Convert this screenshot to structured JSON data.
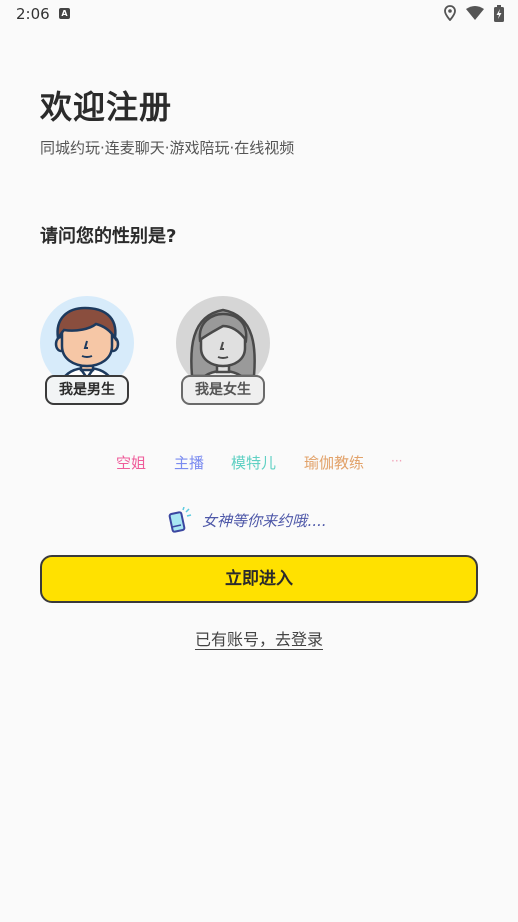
{
  "status_bar": {
    "time": "2:06",
    "notification_icon": "a-letter-icon",
    "icons": [
      "location-icon",
      "wifi-icon",
      "battery-charging-icon"
    ]
  },
  "header": {
    "title": "欢迎注册",
    "subtitle": "同城约玩·连麦聊天·游戏陪玩·在线视频"
  },
  "question": "请问您的性别是?",
  "genders": [
    {
      "label": "我是男生",
      "icon": "male-avatar-icon",
      "selected": true,
      "bg_color": "#d7ebfa"
    },
    {
      "label": "我是女生",
      "icon": "female-avatar-icon",
      "selected": false,
      "bg_color": "#d6d6d6"
    }
  ],
  "tags": [
    {
      "text": "空姐",
      "color": "#ef5c9a"
    },
    {
      "text": "主播",
      "color": "#7a8bf0"
    },
    {
      "text": "模特儿",
      "color": "#5fd0c3"
    },
    {
      "text": "瑜伽教练",
      "color": "#e2a26a"
    },
    {
      "text": "···",
      "color": "#f1a3b8"
    }
  ],
  "slogan": {
    "icon": "phone-sparkle-icon",
    "text": "女神等你来约哦...."
  },
  "enter_button": {
    "label": "立即进入",
    "color": "#ffe100"
  },
  "login_link": "已有账号，去登录"
}
